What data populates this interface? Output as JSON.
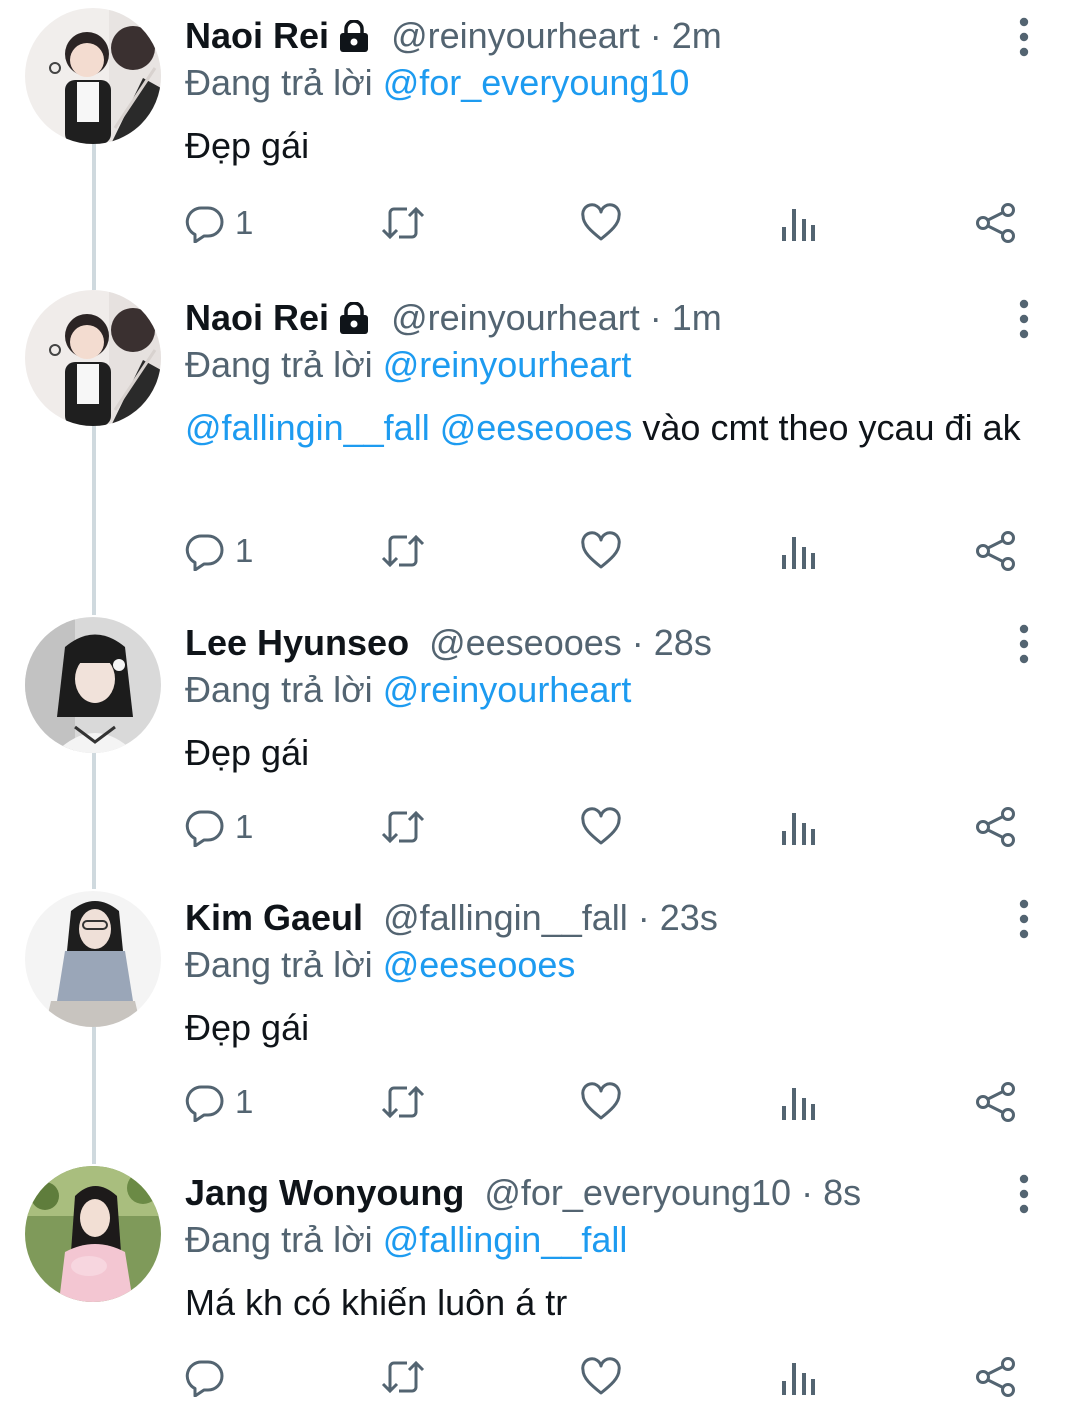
{
  "replying_prefix": "Đang trả lời",
  "tweets": [
    {
      "name": "Naoi Rei",
      "locked": true,
      "handle": "@reinyourheart",
      "time": "· 2m",
      "replying_to": "@for_everyoung10",
      "body_mentions": [],
      "body_text": "Đẹp gái",
      "reply_count": "1"
    },
    {
      "name": "Naoi Rei",
      "locked": true,
      "handle": "@reinyourheart",
      "time": "· 1m",
      "replying_to": "@reinyourheart",
      "body_mentions": [
        "@fallingin__fall",
        "@eeseooes"
      ],
      "body_text": "vào cmt theo ycau đi ak",
      "reply_count": "1"
    },
    {
      "name": "Lee Hyunseo",
      "locked": false,
      "handle": "@eeseooes",
      "time": "· 28s",
      "replying_to": "@reinyourheart",
      "body_mentions": [],
      "body_text": "Đẹp gái",
      "reply_count": "1"
    },
    {
      "name": "Kim Gaeul",
      "locked": false,
      "handle": "@fallingin__fall",
      "time": "· 23s",
      "replying_to": "@eeseooes",
      "body_mentions": [],
      "body_text": "Đẹp gái",
      "reply_count": "1"
    },
    {
      "name": "Jang Wonyoung",
      "locked": false,
      "handle": "@for_everyoung10",
      "time": "· 8s",
      "replying_to": "@fallingin__fall",
      "body_mentions": [],
      "body_text": "Má kh có khiến luôn á tr",
      "reply_count": ""
    }
  ],
  "icons": {
    "reply": "reply-icon",
    "retweet": "retweet-icon",
    "like": "heart-icon",
    "views": "analytics-icon",
    "share": "share-icon",
    "more": "more-vertical-icon",
    "lock": "lock-icon"
  },
  "colors": {
    "text": "#0f1419",
    "secondary": "#536471",
    "link": "#1d9bf0",
    "thread_line": "#cfd9de"
  }
}
